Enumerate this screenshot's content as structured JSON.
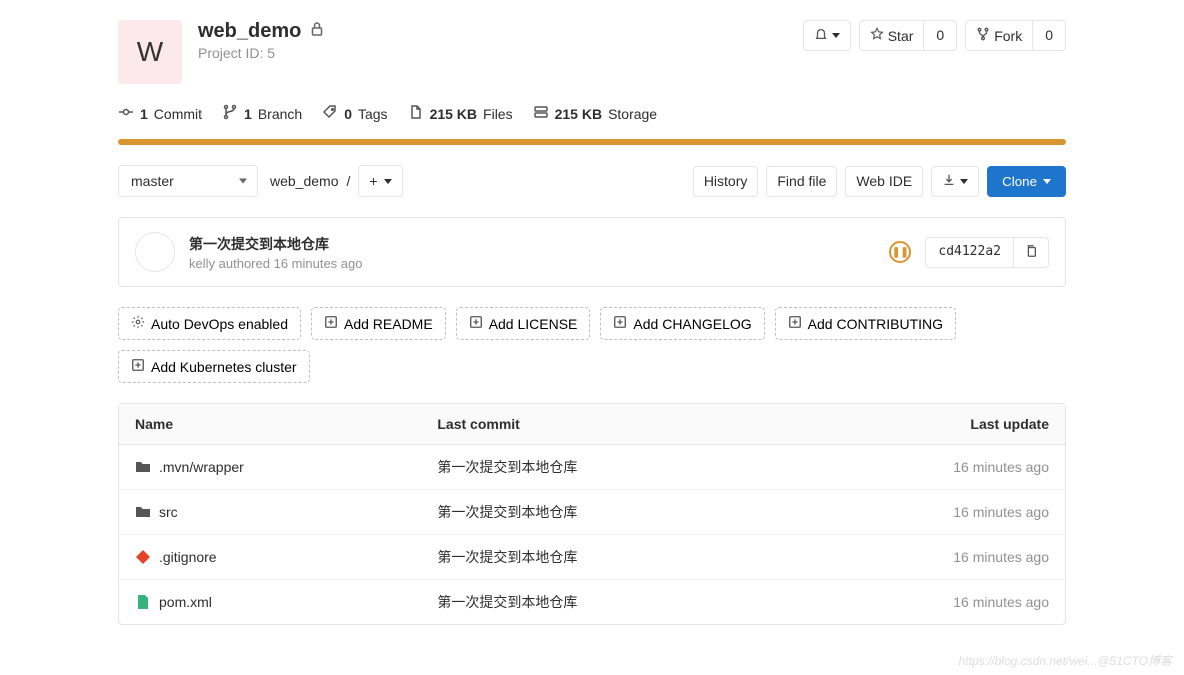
{
  "project": {
    "avatar_letter": "W",
    "name": "web_demo",
    "id_label": "Project ID: 5"
  },
  "actions": {
    "star_label": "Star",
    "star_count": "0",
    "fork_label": "Fork",
    "fork_count": "0"
  },
  "stats": {
    "commits_count": "1",
    "commits_label": "Commit",
    "branches_count": "1",
    "branches_label": "Branch",
    "tags_count": "0",
    "tags_label": "Tags",
    "files_size": "215 KB",
    "files_label": "Files",
    "storage_size": "215 KB",
    "storage_label": "Storage"
  },
  "controls": {
    "branch": "master",
    "breadcrumb_root": "web_demo",
    "history_label": "History",
    "findfile_label": "Find file",
    "webide_label": "Web IDE",
    "clone_label": "Clone"
  },
  "last_commit": {
    "message": "第一次提交到本地仓库",
    "author": "kelly",
    "authored_text": "authored",
    "time": "16 minutes ago",
    "sha": "cd4122a2"
  },
  "suggestions": {
    "autodevops": "Auto DevOps enabled",
    "readme": "Add README",
    "license": "Add LICENSE",
    "changelog": "Add CHANGELOG",
    "contributing": "Add CONTRIBUTING",
    "kubernetes": "Add Kubernetes cluster"
  },
  "table": {
    "col_name": "Name",
    "col_commit": "Last commit",
    "col_update": "Last update",
    "rows": [
      {
        "type": "folder",
        "name": ".mvn/wrapper",
        "commit": "第一次提交到本地仓库",
        "updated": "16 minutes ago"
      },
      {
        "type": "folder",
        "name": "src",
        "commit": "第一次提交到本地仓库",
        "updated": "16 minutes ago"
      },
      {
        "type": "gitignore",
        "name": ".gitignore",
        "commit": "第一次提交到本地仓库",
        "updated": "16 minutes ago"
      },
      {
        "type": "xml",
        "name": "pom.xml",
        "commit": "第一次提交到本地仓库",
        "updated": "16 minutes ago"
      }
    ]
  },
  "watermark": "https://blog.csdn.net/wei...@51CTO博客"
}
